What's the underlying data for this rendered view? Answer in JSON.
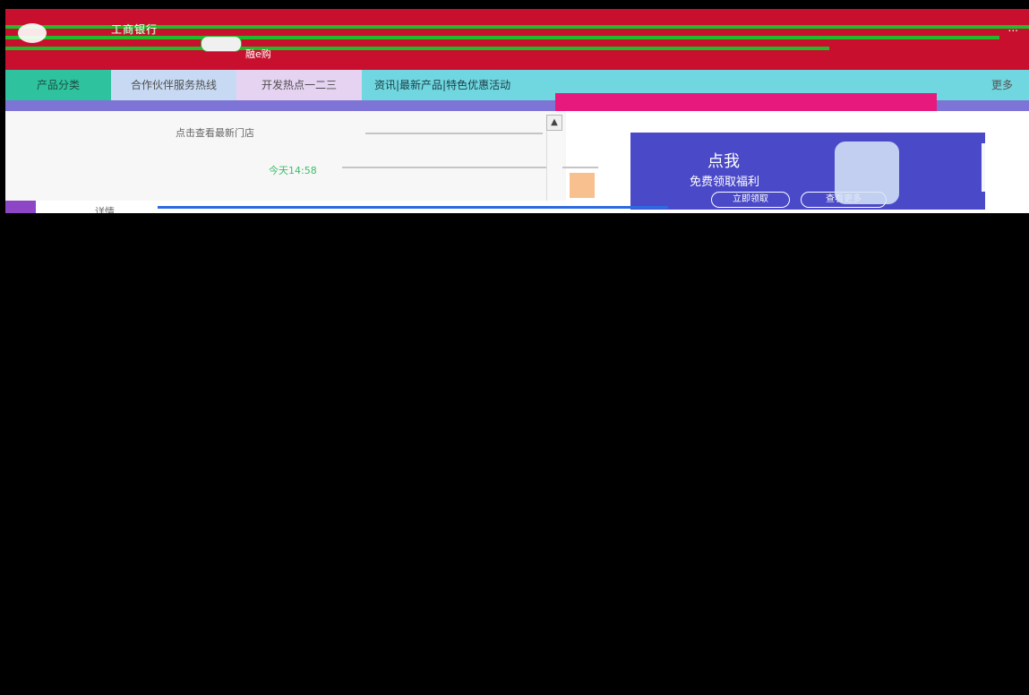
{
  "header": {
    "brand": "工商银行",
    "sub": "融e购",
    "tools": "..."
  },
  "nav": {
    "tabs": [
      "产品分类",
      "合作伙伴服务热线",
      "开发热点一二三"
    ],
    "promo": "资讯|最新产品|特色优惠活动",
    "right": "更多"
  },
  "notice": {
    "line1": "点击查看最新门店",
    "line2": "今天14:58"
  },
  "promo": {
    "title": "点我",
    "subtitle": "免费领取福利",
    "button1": "立即领取",
    "button2": "查看更多"
  },
  "bottom": {
    "tab": "详情"
  },
  "colors": {
    "header_red": "#c8102e",
    "nav_teal": "#70d6df",
    "accent_green": "#1fbd2a",
    "promo_blue": "#4a49c7"
  }
}
